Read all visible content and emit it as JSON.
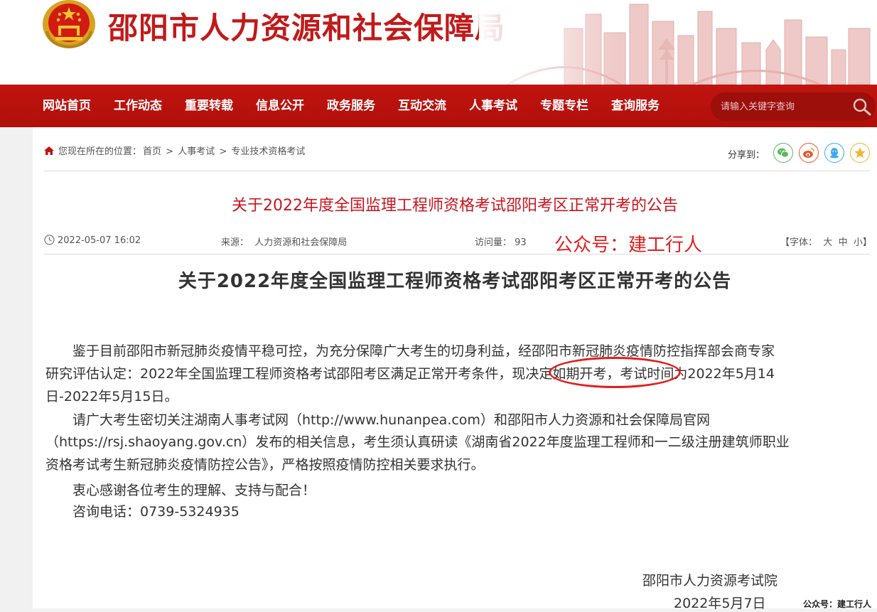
{
  "header": {
    "site_title": "邵阳市人力资源和社会保障局"
  },
  "nav": {
    "items": [
      "网站首页",
      "工作动态",
      "重要转载",
      "信息公开",
      "政务服务",
      "互动交流",
      "人事考试",
      "专题专栏",
      "查询服务"
    ],
    "search_placeholder": "请输入关键字查询"
  },
  "breadcrumb": {
    "prefix": "您现在所在的位置：",
    "items": [
      "首页",
      "人事考试",
      "专业技术资格考试"
    ],
    "separator": ">"
  },
  "share": {
    "label": "分享到：",
    "targets": [
      "wechat",
      "weibo",
      "qq",
      "qzone"
    ]
  },
  "article": {
    "headline": "关于2022年度全国监理工程师资格考试邵阳考区正常开考的公告",
    "date": "2022-05-07 16:02",
    "source_label": "来源：",
    "source": "人力资源和社会保障局",
    "visits_label": "访问量：",
    "visits": "93",
    "font_size_label": "【字体：",
    "font_sizes": [
      "大",
      "中",
      "小"
    ],
    "font_size_close": "】",
    "title": "关于2022年度全国监理工程师资格考试邵阳考区正常开考的公告",
    "lines": [
      "　　鉴于目前邵阳市新冠肺炎疫情平稳可控，为充分保障广大考生的切身利益，经邵阳市新冠肺炎疫情防控指挥部会商专家",
      "研究评估认定：2022年全国监理工程师资格考试邵阳考区满足正常开考条件，现决定如期开考，考试时间为2022年5月14",
      "日-2022年5月15日。",
      "　　请广大考生密切关注湖南人事考试网（http://www.hunanpea.com）和邵阳市人力资源和社会保障局官网",
      "（https://rsj.shaoyang.gov.cn）发布的相关信息，考生须认真研读《湖南省2022年度监理工程师和一二级注册建筑师职业",
      "资格考试考生新冠肺炎疫情防控公告》，严格按照疫情防控相关要求执行。",
      "　　衷心感谢各位考生的理解、支持与配合！",
      "　　咨询电话：0739-5324935"
    ],
    "signature": "邵阳市人力资源考试院",
    "sign_date": "2022年5月7日"
  },
  "watermarks": {
    "main": "公众号：建工行人",
    "corner": "公众号：建工行人"
  },
  "colors": {
    "brand_red": "#c11a1a",
    "nav_red": "#b8120e",
    "headline_red": "#c9151e"
  }
}
